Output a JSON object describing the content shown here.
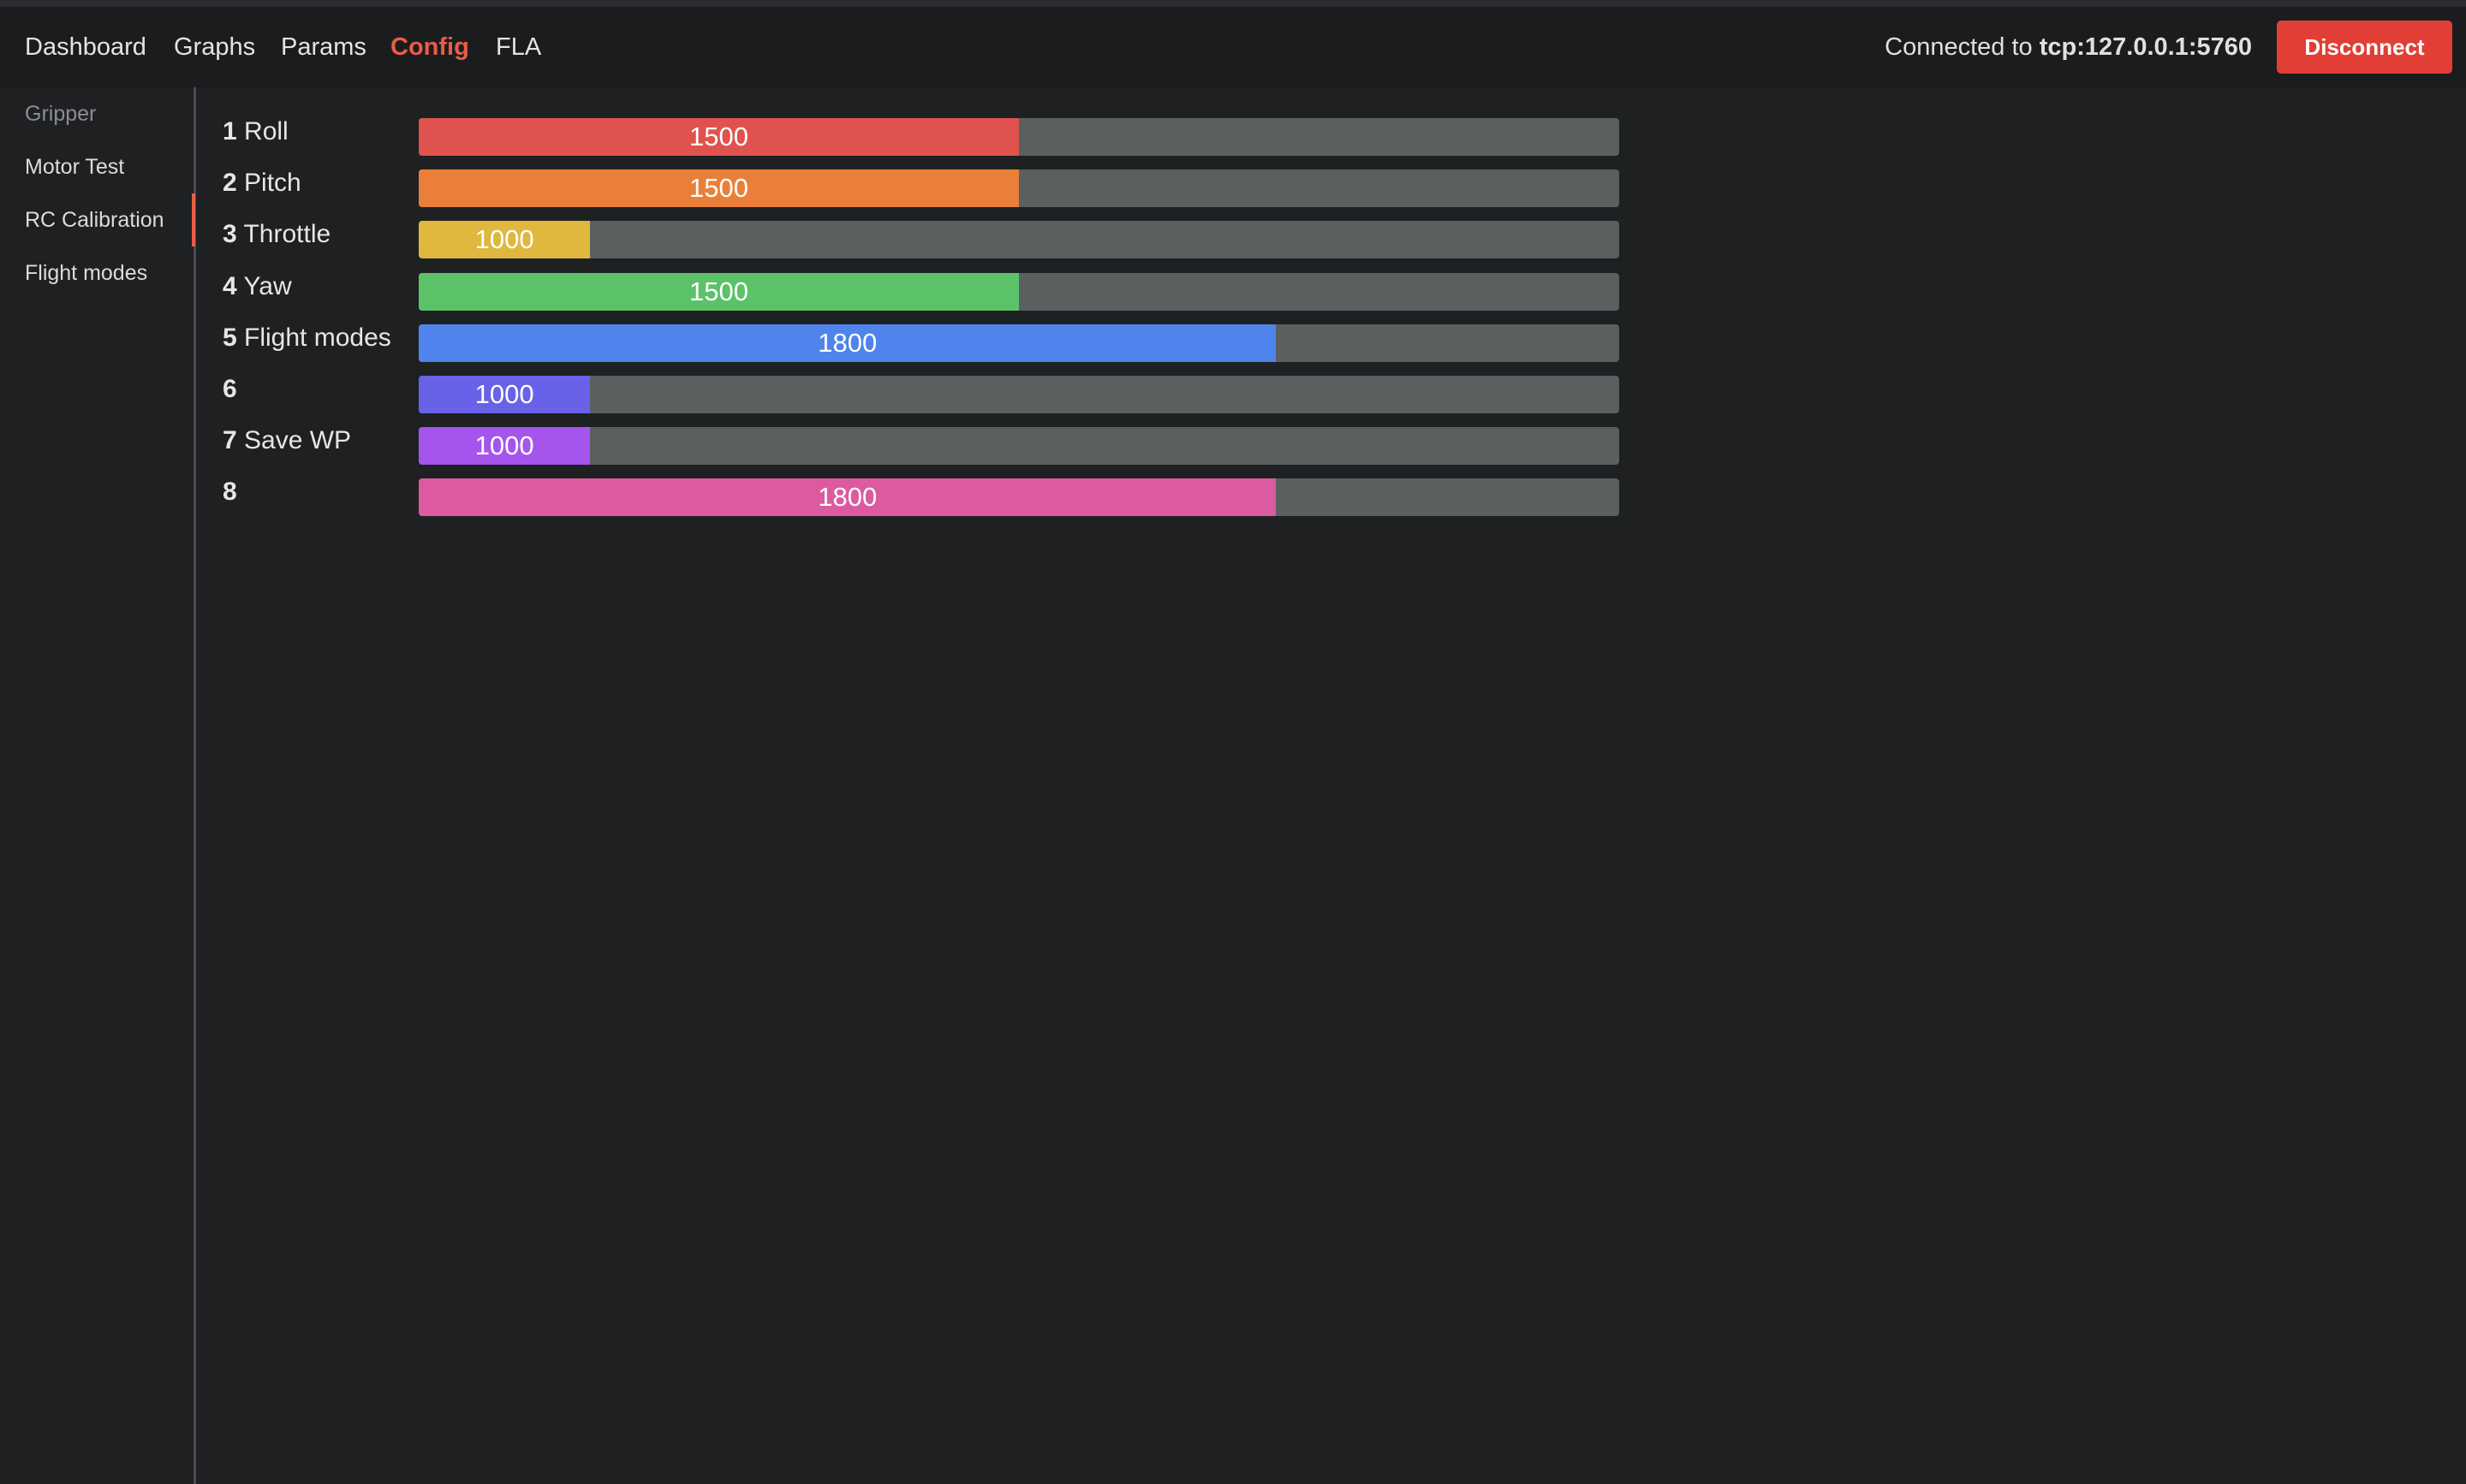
{
  "nav": {
    "links": [
      "Dashboard",
      "Graphs",
      "Params",
      "Config",
      "FLA"
    ],
    "active": "Config"
  },
  "connection": {
    "prefix": "Connected to",
    "address": "tcp:127.0.0.1:5760",
    "disconnect_label": "Disconnect"
  },
  "sidebar": {
    "items": [
      "Gripper",
      "Motor Test",
      "RC Calibration",
      "Flight modes"
    ],
    "active": "RC Calibration"
  },
  "rc": {
    "range_min": 800,
    "range_max": 2200,
    "channels": [
      {
        "num": "1",
        "name": "Roll",
        "value": 1500,
        "color": "#e0524d"
      },
      {
        "num": "2",
        "name": "Pitch",
        "value": 1500,
        "color": "#ea7f3a"
      },
      {
        "num": "3",
        "name": "Throttle",
        "value": 1000,
        "color": "#e0b83f"
      },
      {
        "num": "4",
        "name": "Yaw",
        "value": 1500,
        "color": "#5bc26a"
      },
      {
        "num": "5",
        "name": "Flight modes",
        "value": 1800,
        "color": "#4f84ec"
      },
      {
        "num": "6",
        "name": "",
        "value": 1000,
        "color": "#6862e8"
      },
      {
        "num": "7",
        "name": "Save WP",
        "value": 1000,
        "color": "#a555ec"
      },
      {
        "num": "8",
        "name": "",
        "value": 1800,
        "color": "#dc5a9f"
      }
    ]
  }
}
